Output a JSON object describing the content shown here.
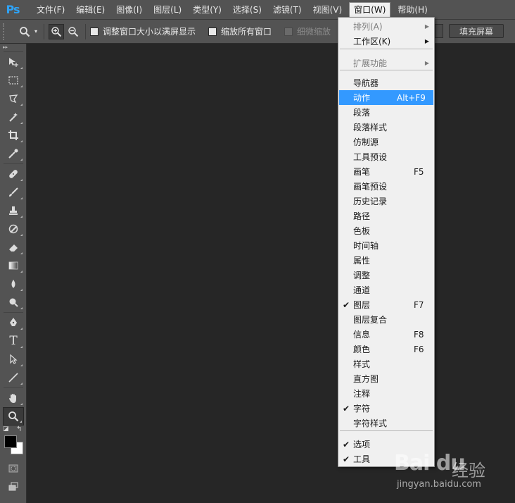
{
  "app": {
    "logo": "Ps"
  },
  "menubar": {
    "items": [
      "文件(F)",
      "编辑(E)",
      "图像(I)",
      "图层(L)",
      "类型(Y)",
      "选择(S)",
      "滤镜(T)",
      "视图(V)",
      "窗口(W)",
      "帮助(H)"
    ],
    "active_index": 8
  },
  "options": {
    "check1": "调整窗口大小以满屏显示",
    "check2": "缩放所有窗口",
    "check3": "细微缩放",
    "fill_button": "填充屏幕"
  },
  "window_menu": {
    "items": [
      {
        "label": "排列(A)",
        "state": "disabled",
        "submenu": true
      },
      {
        "label": "工作区(K)",
        "submenu": true
      },
      {
        "label": "扩展功能",
        "state": "disabled",
        "submenu": true
      },
      {
        "label": "导航器"
      },
      {
        "label": "动作",
        "shortcut": "Alt+F9",
        "highlighted": true
      },
      {
        "label": "段落"
      },
      {
        "label": "段落样式"
      },
      {
        "label": "仿制源"
      },
      {
        "label": "工具预设"
      },
      {
        "label": "画笔",
        "shortcut": "F5"
      },
      {
        "label": "画笔预设"
      },
      {
        "label": "历史记录"
      },
      {
        "label": "路径"
      },
      {
        "label": "色板"
      },
      {
        "label": "时间轴"
      },
      {
        "label": "属性"
      },
      {
        "label": "调整"
      },
      {
        "label": "通道"
      },
      {
        "label": "图层",
        "shortcut": "F7",
        "checked": true
      },
      {
        "label": "图层复合"
      },
      {
        "label": "信息",
        "shortcut": "F8"
      },
      {
        "label": "颜色",
        "shortcut": "F6"
      },
      {
        "label": "样式"
      },
      {
        "label": "直方图"
      },
      {
        "label": "注释"
      },
      {
        "label": "字符",
        "checked": true
      },
      {
        "label": "字符样式"
      },
      {
        "label": "选项",
        "checked": true
      },
      {
        "label": "工具",
        "checked": true
      }
    ]
  },
  "watermark": {
    "logo": "Bai du",
    "cn": "经验",
    "url": "jingyan.baidu.com"
  }
}
